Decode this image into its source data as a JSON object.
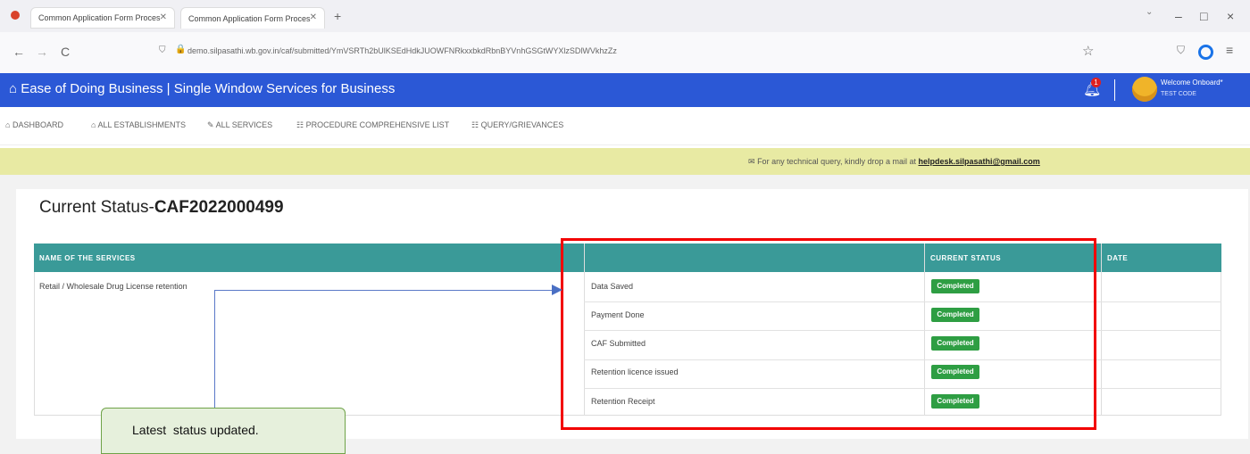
{
  "browser": {
    "tabs": [
      {
        "label": "Common Application Form Proces"
      },
      {
        "label": "Common Application Form Proces"
      }
    ],
    "new_tab": "+",
    "window_controls": {
      "minimize": "–",
      "maximize": "□",
      "close": "×"
    },
    "nav": {
      "back": "←",
      "forward": "→",
      "reload": "C"
    },
    "url": "demo.silpasathi.wb.gov.in/caf/submitted/YmVSRTh2bUlKSEdHdkJUOWFNRkxxbkdRbnBYVnhGSGtWYXlzSDlWVkhzZz",
    "star": "☆"
  },
  "app": {
    "title": "Ease of Doing Business | Single Window Services for Business",
    "notification_count": "1",
    "user": {
      "welcome": "Welcome Onboard*",
      "id": "TEST CODE"
    }
  },
  "menu": [
    {
      "icon": "⌂",
      "label": "DASHBOARD"
    },
    {
      "icon": "⌂",
      "label": "ALL ESTABLISHMENTS"
    },
    {
      "icon": "✎",
      "label": "ALL SERVICES"
    },
    {
      "icon": "☷",
      "label": "PROCEDURE COMPREHENSIVE LIST"
    },
    {
      "icon": "☷",
      "label": "QUERY/GRIEVANCES"
    }
  ],
  "notice": {
    "text": "For any technical query, kindly drop a mail at ",
    "email": "helpdesk.silpasathi@gmail.com"
  },
  "page": {
    "title_prefix": "Current Status-",
    "caf_number": "CAF2022000499"
  },
  "table": {
    "headers": [
      "NAME OF THE SERVICES",
      "",
      "CURRENT STATUS",
      "DATE"
    ],
    "service": "Retail / Wholesale Drug License retention",
    "steps": [
      {
        "name": "Data Saved",
        "status": "Completed"
      },
      {
        "name": "Payment Done",
        "status": "Completed"
      },
      {
        "name": "CAF Submitted",
        "status": "Completed"
      },
      {
        "name": "Retention licence issued",
        "status": "Completed"
      },
      {
        "name": "Retention Receipt",
        "status": "Completed"
      }
    ]
  },
  "annotation": {
    "callout": "Latest  status updated."
  },
  "colors": {
    "appbar": "#2b58d6",
    "table_header": "#3a9a98",
    "badge": "#2e9e43",
    "highlight_box": "#f20000",
    "notice_bg": "#e8eaa3"
  }
}
